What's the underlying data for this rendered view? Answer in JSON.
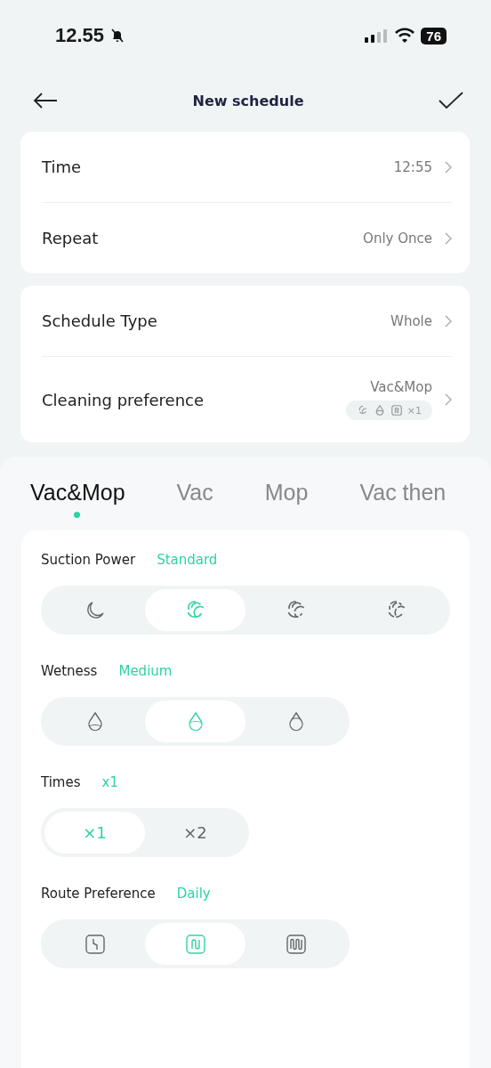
{
  "status_bar": {
    "time": "12.55",
    "battery": "76"
  },
  "header": {
    "title": "New schedule"
  },
  "settings_groups": [
    {
      "rows": [
        {
          "label": "Time",
          "value": "12:55"
        },
        {
          "label": "Repeat",
          "value": "Only Once"
        }
      ]
    },
    {
      "rows": [
        {
          "label": "Schedule Type",
          "value": "Whole"
        },
        {
          "label": "Cleaning preference",
          "value": "Vac&Mop",
          "summary": {
            "icons": [
              {
                "kind": "swirl"
              },
              {
                "kind": "drop"
              },
              {
                "kind": "route"
              }
            ],
            "times": "×1"
          }
        }
      ]
    }
  ],
  "mode_tabs": [
    {
      "label": "Vac&Mop",
      "selected": true
    },
    {
      "label": "Vac",
      "selected": false
    },
    {
      "label": "Mop",
      "selected": false
    },
    {
      "label": "Vac then",
      "selected": false
    }
  ],
  "sections": [
    {
      "label": "Suction Power",
      "value": "Standard",
      "options": [
        {
          "kind": "moon",
          "selected": false
        },
        {
          "kind": "swirl",
          "selected": true
        },
        {
          "kind": "swirl-strong",
          "selected": false
        },
        {
          "kind": "swirl-max",
          "selected": false
        }
      ]
    },
    {
      "label": "Wetness",
      "value": "Medium",
      "options": [
        {
          "kind": "drop-low",
          "selected": false
        },
        {
          "kind": "drop-medium",
          "selected": true
        },
        {
          "kind": "drop-high",
          "selected": false
        }
      ]
    },
    {
      "label": "Times",
      "value": "x1",
      "options": [
        {
          "kind": "text",
          "label": "×1",
          "selected": true
        },
        {
          "kind": "text",
          "label": "×2",
          "selected": false
        }
      ]
    },
    {
      "label": "Route Preference",
      "value": "Daily",
      "options": [
        {
          "kind": "route-quick",
          "selected": false
        },
        {
          "kind": "route-daily",
          "selected": true
        },
        {
          "kind": "route-deep",
          "selected": false
        }
      ]
    }
  ]
}
